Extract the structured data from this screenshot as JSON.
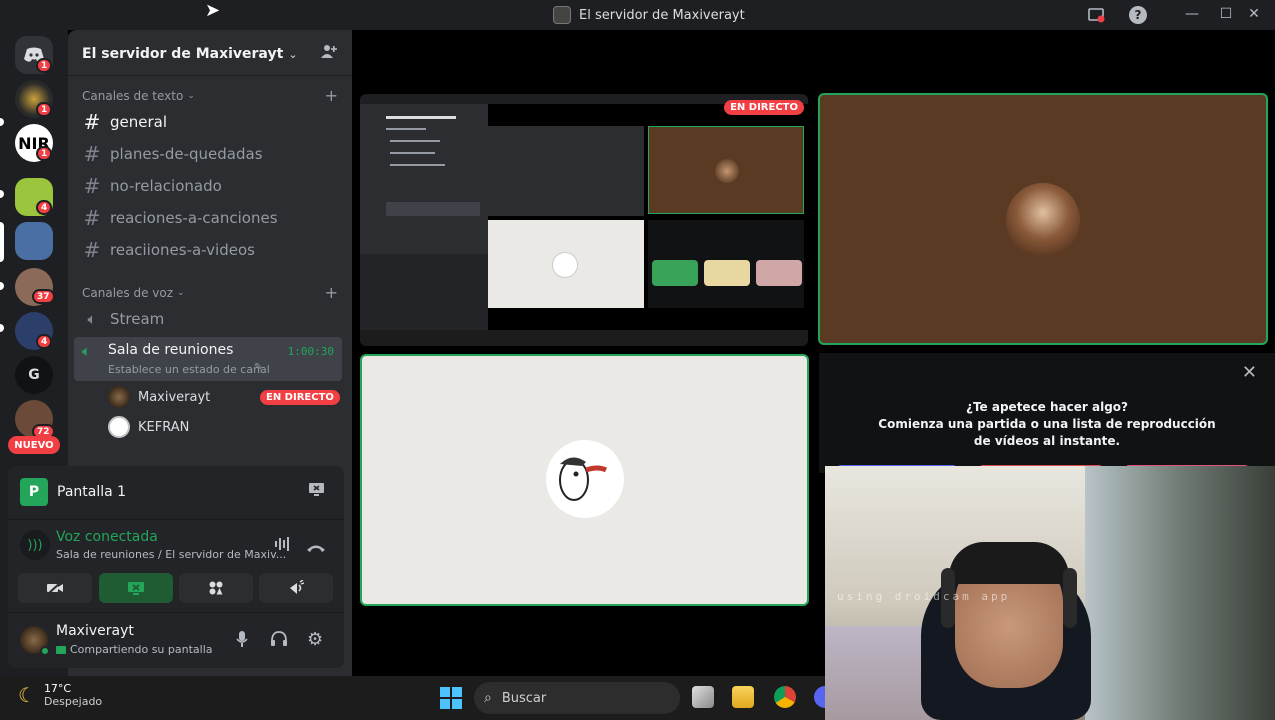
{
  "window": {
    "title": "El servidor de Maxiverayt",
    "minimize": "—",
    "maximize": "☐",
    "close": "✕",
    "help": "?"
  },
  "rail": {
    "badges": [
      "1",
      "1",
      "1",
      "4",
      "37",
      "4",
      "72"
    ],
    "g_label": "G",
    "nuevo": "NUEVO"
  },
  "sidebar": {
    "server_name": "El servidor de Maxiverayt",
    "text_category": "Canales de texto",
    "text_channels": [
      "general",
      "planes-de-quedadas",
      "no-relacionado",
      "reaciones-a-canciones",
      "reaciiones-a-videos"
    ],
    "voice_category": "Canales de voz",
    "voice_channels": {
      "stream": "Stream",
      "room": "Sala de reuniones",
      "room_timer": "1:00:30",
      "room_status": "Establece un estado de canal"
    },
    "members": [
      {
        "name": "Maxiverayt",
        "badge": "EN DIRECTO"
      },
      {
        "name": "KEFRAN",
        "badge": ""
      }
    ]
  },
  "panel": {
    "screen_title": "Pantalla 1",
    "voice_status": "Voz conectada",
    "voice_location": "Sala de reuniones / El servidor de Maxiv...",
    "user_name": "Maxiverayt",
    "user_status": "Compartiendo su pantalla"
  },
  "stage": {
    "live_label": "EN DIRECTO",
    "activity_title": "¿Te apetece hacer algo?",
    "activity_subtitle": "Comienza una partida o una lista de reproducción de vídeos al instante.",
    "webcam_watermark": "using droidcam app"
  },
  "taskbar": {
    "temperature": "17°C",
    "weather": "Despejado",
    "search_placeholder": "Buscar"
  },
  "colors": {
    "live_red": "#f23f43",
    "speaking_green": "#23a55a",
    "tile_brown": "#5b3a24"
  }
}
